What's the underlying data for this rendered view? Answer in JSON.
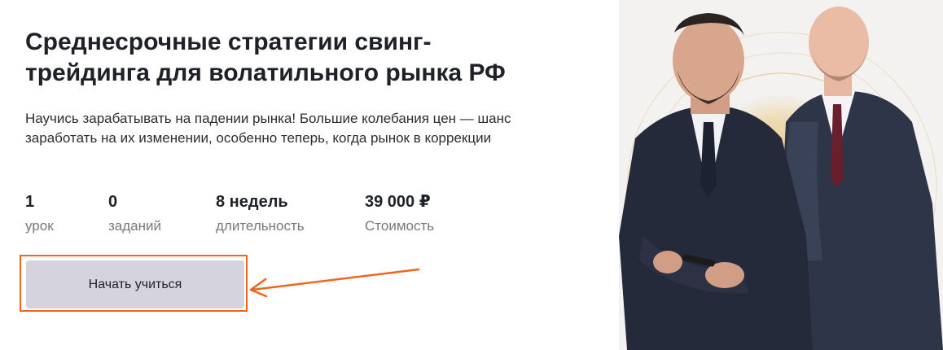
{
  "course": {
    "title": "Среднесрочные стратегии свинг-трейдинга для волатильного рынка РФ",
    "description": "Научись зарабатывать на падении рынка! Большие колебания цен — шанс заработать на их изменении, особенно теперь, когда рынок в коррекции",
    "stats": [
      {
        "value": "1",
        "label": "урок"
      },
      {
        "value": "0",
        "label": "заданий"
      },
      {
        "value": "8 недель",
        "label": "длительность"
      },
      {
        "value": "39 000 ₽",
        "label": "Стоимость"
      }
    ],
    "cta_label": "Начать учиться"
  },
  "colors": {
    "accent": "#f0641c",
    "button_bg": "#d4d3de",
    "text": "#1f2128",
    "muted": "#77787d"
  },
  "icons": {
    "annotation": "arrow-left-icon"
  },
  "hero_image": "two-instructors-photo"
}
